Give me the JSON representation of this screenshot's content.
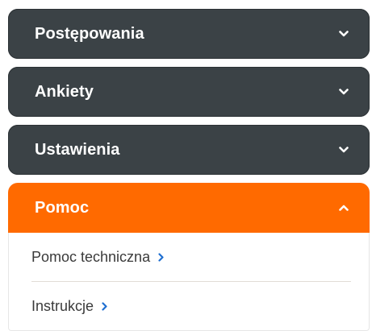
{
  "menu": {
    "sections": [
      {
        "label": "Postępowania",
        "expanded": false,
        "icon": "chevron-down-icon"
      },
      {
        "label": "Ankiety",
        "expanded": false,
        "icon": "chevron-down-icon"
      },
      {
        "label": "Ustawienia",
        "expanded": false,
        "icon": "chevron-down-icon"
      },
      {
        "label": "Pomoc",
        "expanded": true,
        "icon": "chevron-up-icon"
      }
    ],
    "help_items": [
      {
        "label": "Pomoc techniczna",
        "icon": "chevron-right-icon"
      },
      {
        "label": "Instrukcje",
        "icon": "chevron-right-icon"
      }
    ]
  },
  "colors": {
    "header_bg": "#3b4246",
    "active_bg": "#ff6a00",
    "header_text": "#ffffff",
    "sub_text": "#3a3a3a",
    "sub_arrow": "#1f6fd1"
  }
}
